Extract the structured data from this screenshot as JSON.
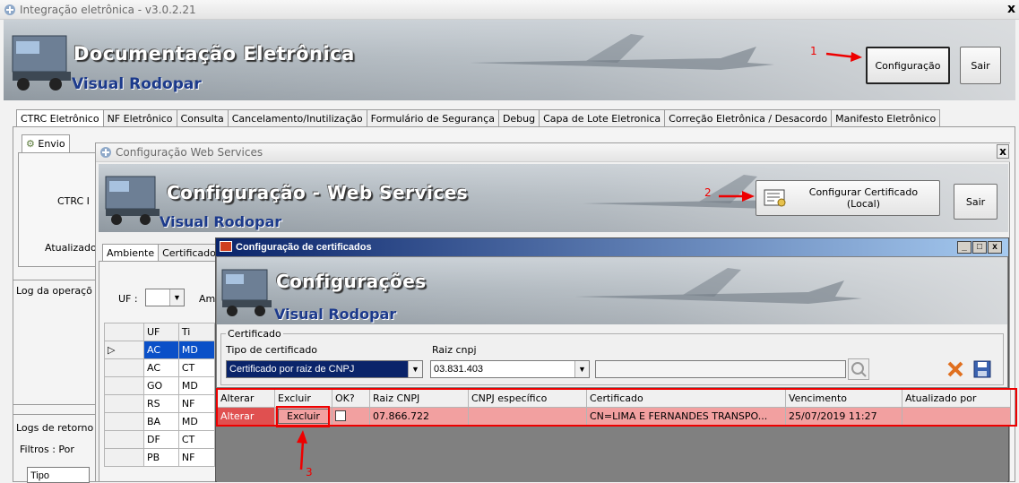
{
  "main_window": {
    "title": "Integração eletrônica - v3.0.2.21",
    "close_label": "x",
    "banner_title": "Documentação Eletrônica",
    "banner_sub": "Visual Rodopar",
    "config_button": "Configuração",
    "exit_button": "Sair",
    "tabs": [
      "CTRC Eletrônico",
      "NF Eletrônico",
      "Consulta",
      "Cancelamento/Inutilização",
      "Formulário de Segurança",
      "Debug",
      "Capa de Lote Eletronica",
      "Correção Eletrônica / Desacordo",
      "Manifesto Eletrônico"
    ],
    "subtab_envio": "Envio",
    "ctrc_label": "CTRC I",
    "atualizado_label": "Atualizado",
    "log_label": "Log da operaçõ",
    "logs_retorno_label": "Logs de retorno",
    "filtros_label": "Filtros :   Por",
    "tipo_label": "Tipo"
  },
  "ws_window": {
    "title": "Configuração Web Services",
    "close_label": "x",
    "banner_title": "Configuração - Web Services",
    "banner_sub": "Visual Rodopar",
    "config_cert_button": "Configurar Certificado (Local)",
    "exit_button": "Sair",
    "tabs": [
      "Ambiente",
      "Certificado"
    ],
    "uf_label": "UF :",
    "am_label": "Am",
    "uf_grid_headers": [
      "UF",
      "Ti"
    ],
    "uf_grid_rows": [
      {
        "uf": "AC",
        "tipo": "MD",
        "selected": true
      },
      {
        "uf": "AC",
        "tipo": "CT",
        "selected": false
      },
      {
        "uf": "GO",
        "tipo": "MD",
        "selected": false
      },
      {
        "uf": "RS",
        "tipo": "NF",
        "selected": false
      },
      {
        "uf": "BA",
        "tipo": "MD",
        "selected": false
      },
      {
        "uf": "DF",
        "tipo": "CT",
        "selected": false
      },
      {
        "uf": "PB",
        "tipo": "NF",
        "selected": false
      }
    ]
  },
  "cert_window": {
    "title": "Configuração de certificados",
    "control_buttons": [
      "_",
      "□",
      "x"
    ],
    "banner_title": "Configurações",
    "banner_sub": "Visual Rodopar",
    "group_label": "Certificado",
    "tipo_label": "Tipo de certificado",
    "tipo_value": "Certificado por raiz de CNPJ",
    "raiz_label": "Raiz cnpj",
    "raiz_value": "03.831.403",
    "grid_headers": [
      "Alterar",
      "Excluir",
      "OK?",
      "Raiz CNPJ",
      "CNPJ específico",
      "Certificado",
      "Vencimento",
      "Atualizado por"
    ],
    "grid_rows": [
      {
        "alterar": "Alterar",
        "excluir": "Excluir",
        "raiz": "07.866.722",
        "especifico": "",
        "certificado": "CN=LIMA E FERNANDES TRANSPO...",
        "vencimento": "25/07/2019 11:27",
        "atualizado": ""
      }
    ]
  },
  "annotations": {
    "step1": "1",
    "step2": "2",
    "step3": "3",
    "color": "#e00000"
  }
}
